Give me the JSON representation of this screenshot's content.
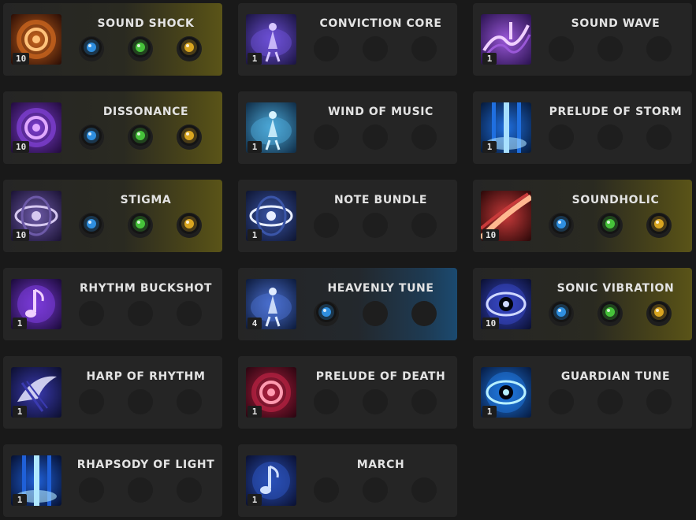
{
  "skills": [
    {
      "name": "SOUND SHOCK",
      "level": "10",
      "icon": "sound-shock-icon",
      "highlight": "gold",
      "runes": [
        "blue-burst-rune",
        "green-spiral-rune",
        "gold-key-rune"
      ]
    },
    {
      "name": "CONVICTION CORE",
      "level": "1",
      "icon": "conviction-core-icon",
      "highlight": "",
      "runes": []
    },
    {
      "name": "SOUND WAVE",
      "level": "1",
      "icon": "sound-wave-icon",
      "highlight": "",
      "runes": []
    },
    {
      "name": "DISSONANCE",
      "level": "10",
      "icon": "dissonance-icon",
      "highlight": "gold",
      "runes": [
        "blue-note-rune",
        "green-skull-rune",
        "gold-spiral-rune"
      ]
    },
    {
      "name": "WIND OF MUSIC",
      "level": "1",
      "icon": "wind-of-music-icon",
      "highlight": "",
      "runes": []
    },
    {
      "name": "PRELUDE OF STORM",
      "level": "1",
      "icon": "prelude-of-storm-icon",
      "highlight": "",
      "runes": []
    },
    {
      "name": "STIGMA",
      "level": "10",
      "icon": "stigma-icon",
      "highlight": "gold",
      "runes": [
        "blue-arrow-rune",
        "green-star-rune",
        "gold-sun-rune"
      ]
    },
    {
      "name": "NOTE BUNDLE",
      "level": "1",
      "icon": "note-bundle-icon",
      "highlight": "",
      "runes": []
    },
    {
      "name": "SOUNDHOLIC",
      "level": "10",
      "icon": "soundholic-icon",
      "highlight": "gold",
      "runes": [
        "blue-spread-rune",
        "green-down-arrow-rune",
        "gold-cross-rune"
      ]
    },
    {
      "name": "RHYTHM BUCKSHOT",
      "level": "1",
      "icon": "rhythm-buckshot-icon",
      "highlight": "",
      "runes": []
    },
    {
      "name": "HEAVENLY TUNE",
      "level": "4",
      "icon": "heavenly-tune-icon",
      "highlight": "blue",
      "runes": [
        "blue-swirl-rune"
      ]
    },
    {
      "name": "SONIC VIBRATION",
      "level": "10",
      "icon": "sonic-vibration-icon",
      "highlight": "gold",
      "runes": [
        "blue-figure-rune",
        "green-arrow-rune",
        "gold-key-rune"
      ]
    },
    {
      "name": "HARP OF RHYTHM",
      "level": "1",
      "icon": "harp-of-rhythm-icon",
      "highlight": "",
      "runes": []
    },
    {
      "name": "PRELUDE OF DEATH",
      "level": "1",
      "icon": "prelude-of-death-icon",
      "highlight": "",
      "runes": []
    },
    {
      "name": "GUARDIAN TUNE",
      "level": "1",
      "icon": "guardian-tune-icon",
      "highlight": "",
      "runes": []
    },
    {
      "name": "RHAPSODY OF LIGHT",
      "level": "1",
      "icon": "rhapsody-of-light-icon",
      "highlight": "",
      "runes": []
    },
    {
      "name": "MARCH",
      "level": "1",
      "icon": "march-icon",
      "highlight": "",
      "runes": []
    }
  ],
  "colors": {
    "gold_highlight": "#5a5418",
    "blue_highlight": "#1b4a70",
    "rune_blue": "#2f8fe0",
    "rune_green": "#46c23a",
    "rune_gold": "#d9a520"
  }
}
